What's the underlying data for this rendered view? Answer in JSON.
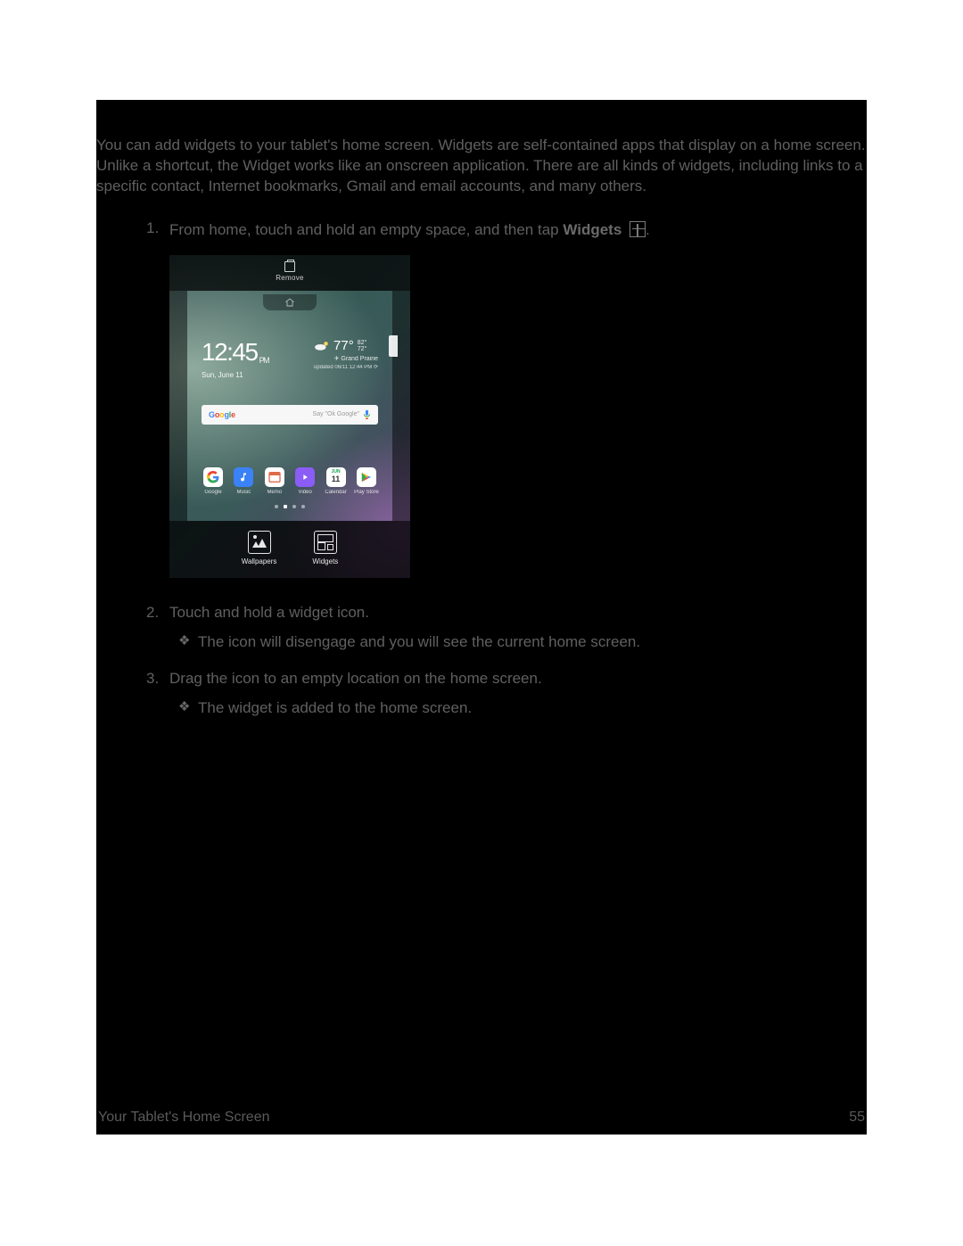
{
  "intro_text": "You can add widgets to your tablet's home screen. Widgets are self-contained apps that display on a home screen. Unlike a shortcut, the Widget works like an onscreen application. There are all kinds of widgets, including links to a specific contact, Internet bookmarks, Gmail and email accounts, and many others.",
  "steps": {
    "s1_num": "1.",
    "s1_pre": "From home, touch and hold an empty space, and then tap ",
    "s1_bold": "Widgets",
    "s1_post": ".",
    "s2_num": "2.",
    "s2_text": "Touch and hold a widget icon.",
    "s2_sub": "The icon will disengage and you will see the current home screen.",
    "s3_num": "3.",
    "s3_text": "Drag the icon to an empty location on the home screen.",
    "s3_sub": "The widget is added to the home screen."
  },
  "bullet_glyph": "❖",
  "figure": {
    "top_remove": "Remove",
    "time": "12:45",
    "ampm": "PM",
    "date": "Sun, June 11",
    "temp": "77°",
    "temp_hi": "82°",
    "temp_lo": "72°",
    "weather_loc": "✈ Grand Prairie",
    "weather_sub": "updated 06/11 12:44 PM ⟳",
    "search_brand": "Google",
    "search_hint": "Say \"Ok Google\"",
    "apps": {
      "a1": "Google",
      "a2": "Music",
      "a3": "Memo",
      "a4": "Video",
      "a5": "Calendar",
      "a6": "Play Store"
    },
    "bottom": {
      "wallpapers": "Wallpapers",
      "widgets": "Widgets"
    }
  },
  "footer": {
    "left": "Your Tablet's Home Screen",
    "right": "55"
  }
}
